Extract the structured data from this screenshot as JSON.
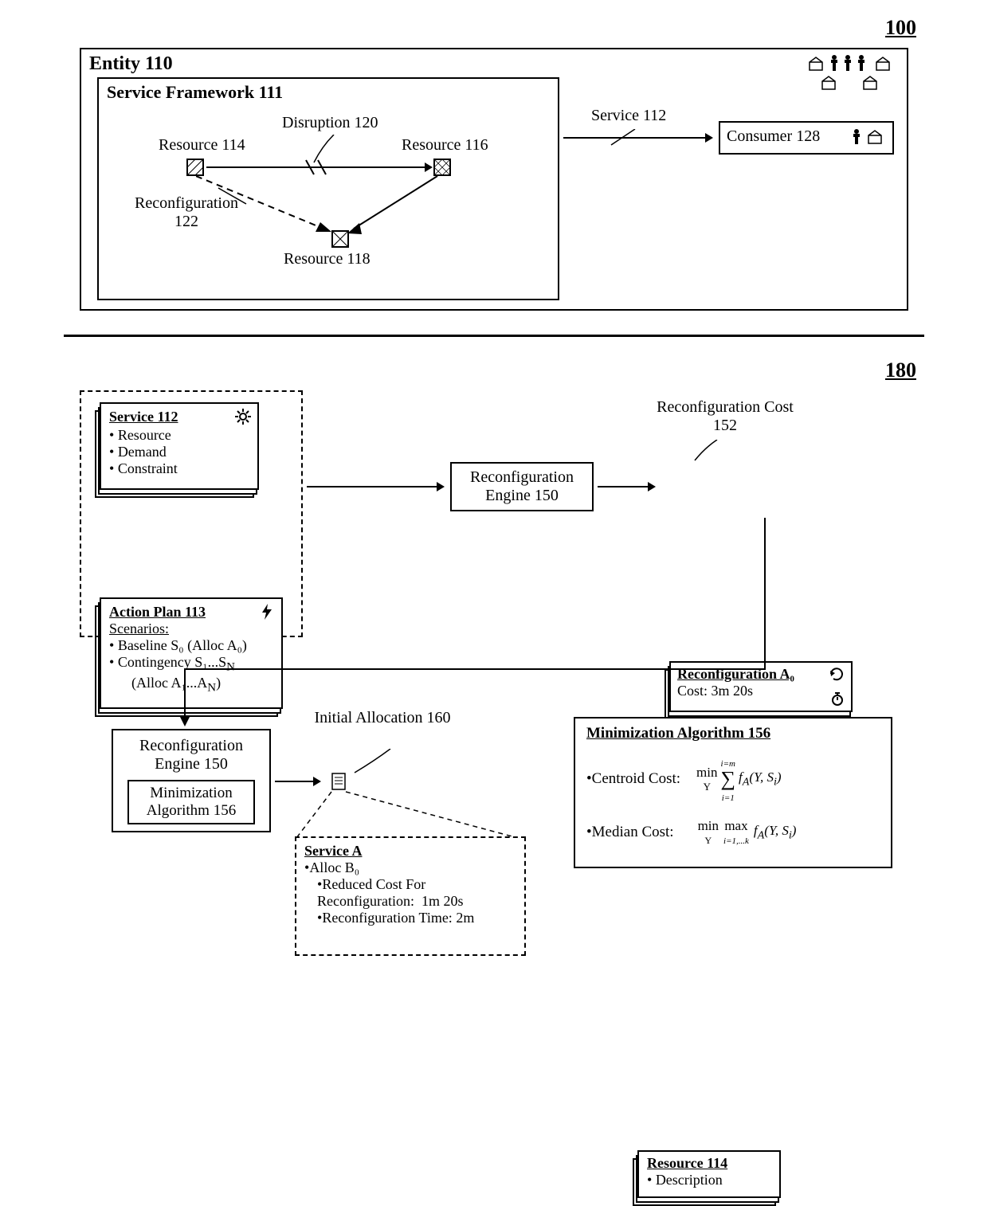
{
  "fig1": {
    "ref": "100",
    "entity_label": "Entity 110",
    "framework_label": "Service Framework 111",
    "resource114": "Resource 114",
    "resource116": "Resource 116",
    "resource118": "Resource 118",
    "disruption": "Disruption 120",
    "reconfiguration": "Reconfiguration 122",
    "service": "Service 112",
    "consumer": "Consumer 128"
  },
  "fig2": {
    "ref": "180",
    "service_card": {
      "title": "Service 112",
      "items": [
        "Resource",
        "Demand",
        "Constraint"
      ]
    },
    "action_card": {
      "title": "Action Plan 113",
      "scenarios_label": "Scenarios:",
      "baseline": "Baseline S₀ (Alloc A₀)",
      "contingency_a": "Contingency S₁...S",
      "contingency_n": "N",
      "contingency_b": "(Alloc A₁...A",
      "contingency_bn": "N",
      "contingency_b2": ")"
    },
    "engine": "Reconfiguration Engine 150",
    "cost_label": "Reconfiguration Cost 152",
    "cost_card": {
      "title": "Reconfiguration A₀",
      "cost": "Cost: 3m 20s"
    },
    "min_alg": "Minimization Algorithm 156",
    "initial_alloc": "Initial Allocation 160",
    "service_a": {
      "title": "Service A",
      "alloc": "Alloc B₀",
      "reduced_cost_label": "Reduced Cost For Reconfiguration:",
      "reduced_cost_value": "1m 20s",
      "reconfig_time_label": "Reconfiguration Time:",
      "reconfig_time_value": "2m"
    },
    "min_panel": {
      "title": "Minimization Algorithm 156",
      "centroid": "Centroid Cost:",
      "centroid_formula": {
        "min": "min",
        "sub": "Y",
        "sum": "∑",
        "sum_top": "i=m",
        "sum_bot": "i=1",
        "f": "f_A(Y, S_i)"
      },
      "median": "Median Cost:",
      "median_formula": {
        "min": "min",
        "minSub": "Y",
        "max": "max",
        "maxSub": "i=1,...k",
        "f": "f_A(Y, S_i)"
      }
    },
    "resource_card": {
      "title": "Resource 114",
      "desc": "Description"
    }
  }
}
